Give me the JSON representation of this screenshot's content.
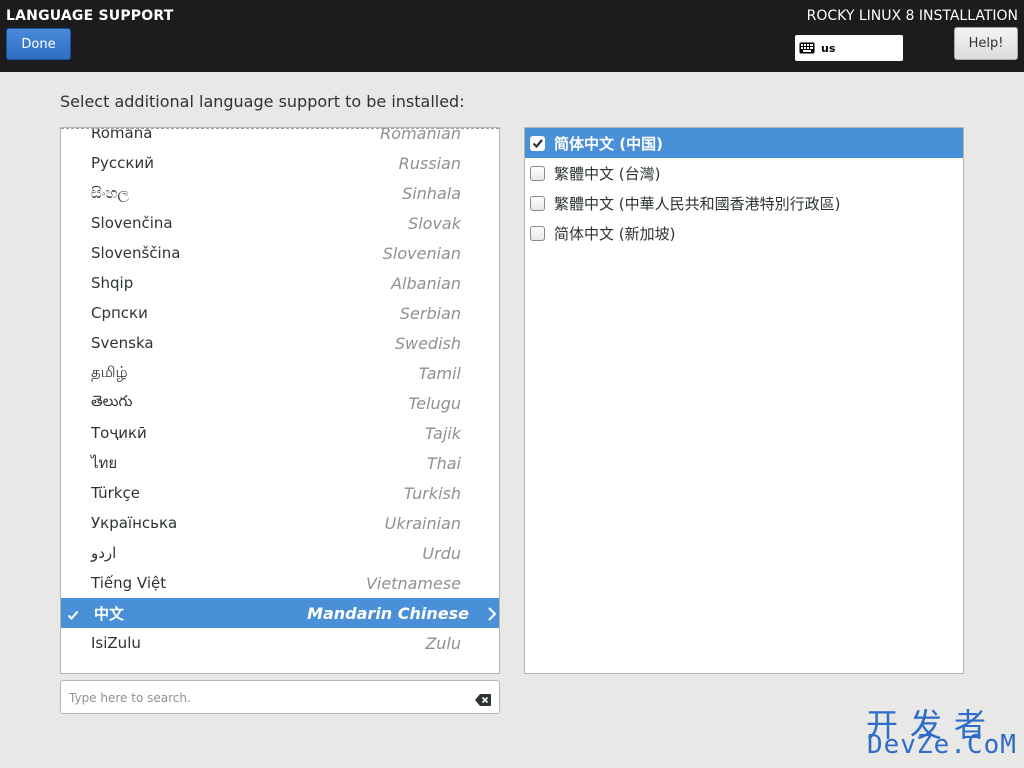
{
  "header": {
    "spoke_title": "LANGUAGE SUPPORT",
    "done_label": "Done",
    "product_title": "ROCKY LINUX 8 INSTALLATION",
    "keyboard_layout": "us",
    "help_label": "Help!"
  },
  "prompt": "Select additional language support to be installed:",
  "languages": [
    {
      "native": "Română",
      "english": "Romanian"
    },
    {
      "native": "Русский",
      "english": "Russian"
    },
    {
      "native": "සිංහල",
      "english": "Sinhala"
    },
    {
      "native": "Slovenčina",
      "english": "Slovak"
    },
    {
      "native": "Slovenščina",
      "english": "Slovenian"
    },
    {
      "native": "Shqip",
      "english": "Albanian"
    },
    {
      "native": "Српски",
      "english": "Serbian"
    },
    {
      "native": "Svenska",
      "english": "Swedish"
    },
    {
      "native": "தமிழ்",
      "english": "Tamil"
    },
    {
      "native": "తెలుగు",
      "english": "Telugu"
    },
    {
      "native": "Тоҷикӣ",
      "english": "Tajik"
    },
    {
      "native": "ไทย",
      "english": "Thai"
    },
    {
      "native": "Türkçe",
      "english": "Turkish"
    },
    {
      "native": "Українська",
      "english": "Ukrainian"
    },
    {
      "native": "اردو",
      "english": "Urdu"
    },
    {
      "native": "Tiếng Việt",
      "english": "Vietnamese"
    },
    {
      "native": "中文",
      "english": "Mandarin Chinese"
    },
    {
      "native": "IsiZulu",
      "english": "Zulu"
    }
  ],
  "selected_language_index": 16,
  "locales": [
    {
      "label": "简体中文 (中国)",
      "checked": true
    },
    {
      "label": "繁體中文 (台灣)",
      "checked": false
    },
    {
      "label": "繁體中文 (中華人民共和國香港特別行政區)",
      "checked": false
    },
    {
      "label": "简体中文 (新加坡)",
      "checked": false
    }
  ],
  "search": {
    "placeholder": "Type here to search.",
    "value": ""
  },
  "watermark": {
    "top": "开发者",
    "bottom": "DevZe.CoM"
  },
  "colors": {
    "accent": "#4a90d9",
    "topbar": "#1c1c1e",
    "watermark": "#2f6bc8"
  }
}
